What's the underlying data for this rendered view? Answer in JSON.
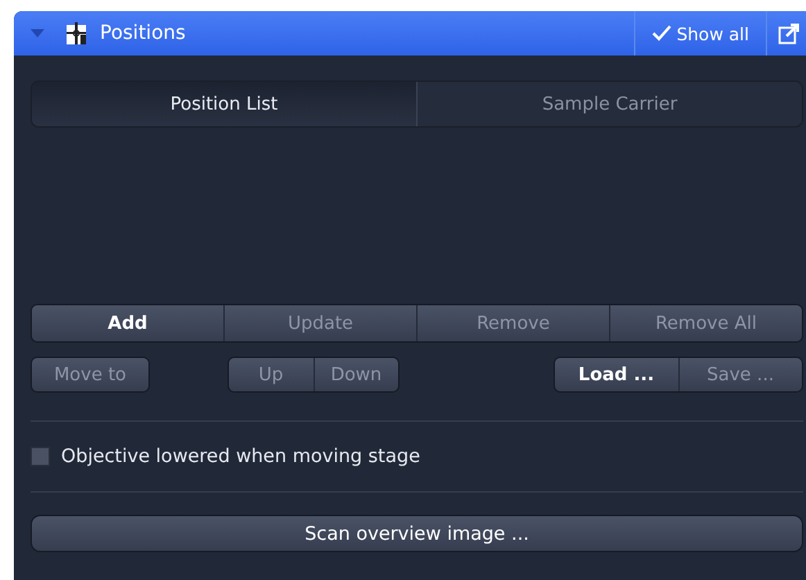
{
  "panel": {
    "title": "Positions",
    "expanded": true,
    "show_all": {
      "label": "Show all",
      "checked": true
    }
  },
  "tabs": [
    {
      "label": "Position List",
      "selected": true
    },
    {
      "label": "Sample Carrier",
      "selected": false
    }
  ],
  "list_buttons": [
    {
      "label": "Add",
      "disabled": false
    },
    {
      "label": "Update",
      "disabled": true
    },
    {
      "label": "Remove",
      "disabled": true
    },
    {
      "label": "Remove All",
      "disabled": true
    }
  ],
  "move_to": {
    "label": "Move to",
    "disabled": true
  },
  "order_buttons": [
    {
      "label": "Up",
      "disabled": true
    },
    {
      "label": "Down",
      "disabled": true
    }
  ],
  "file_buttons": [
    {
      "label": "Load ...",
      "disabled": false
    },
    {
      "label": "Save ...",
      "disabled": true
    }
  ],
  "objective_lowered": {
    "label": "Objective lowered when moving stage",
    "checked": false
  },
  "scan_button": {
    "label": "Scan overview image ...",
    "disabled": false
  }
}
